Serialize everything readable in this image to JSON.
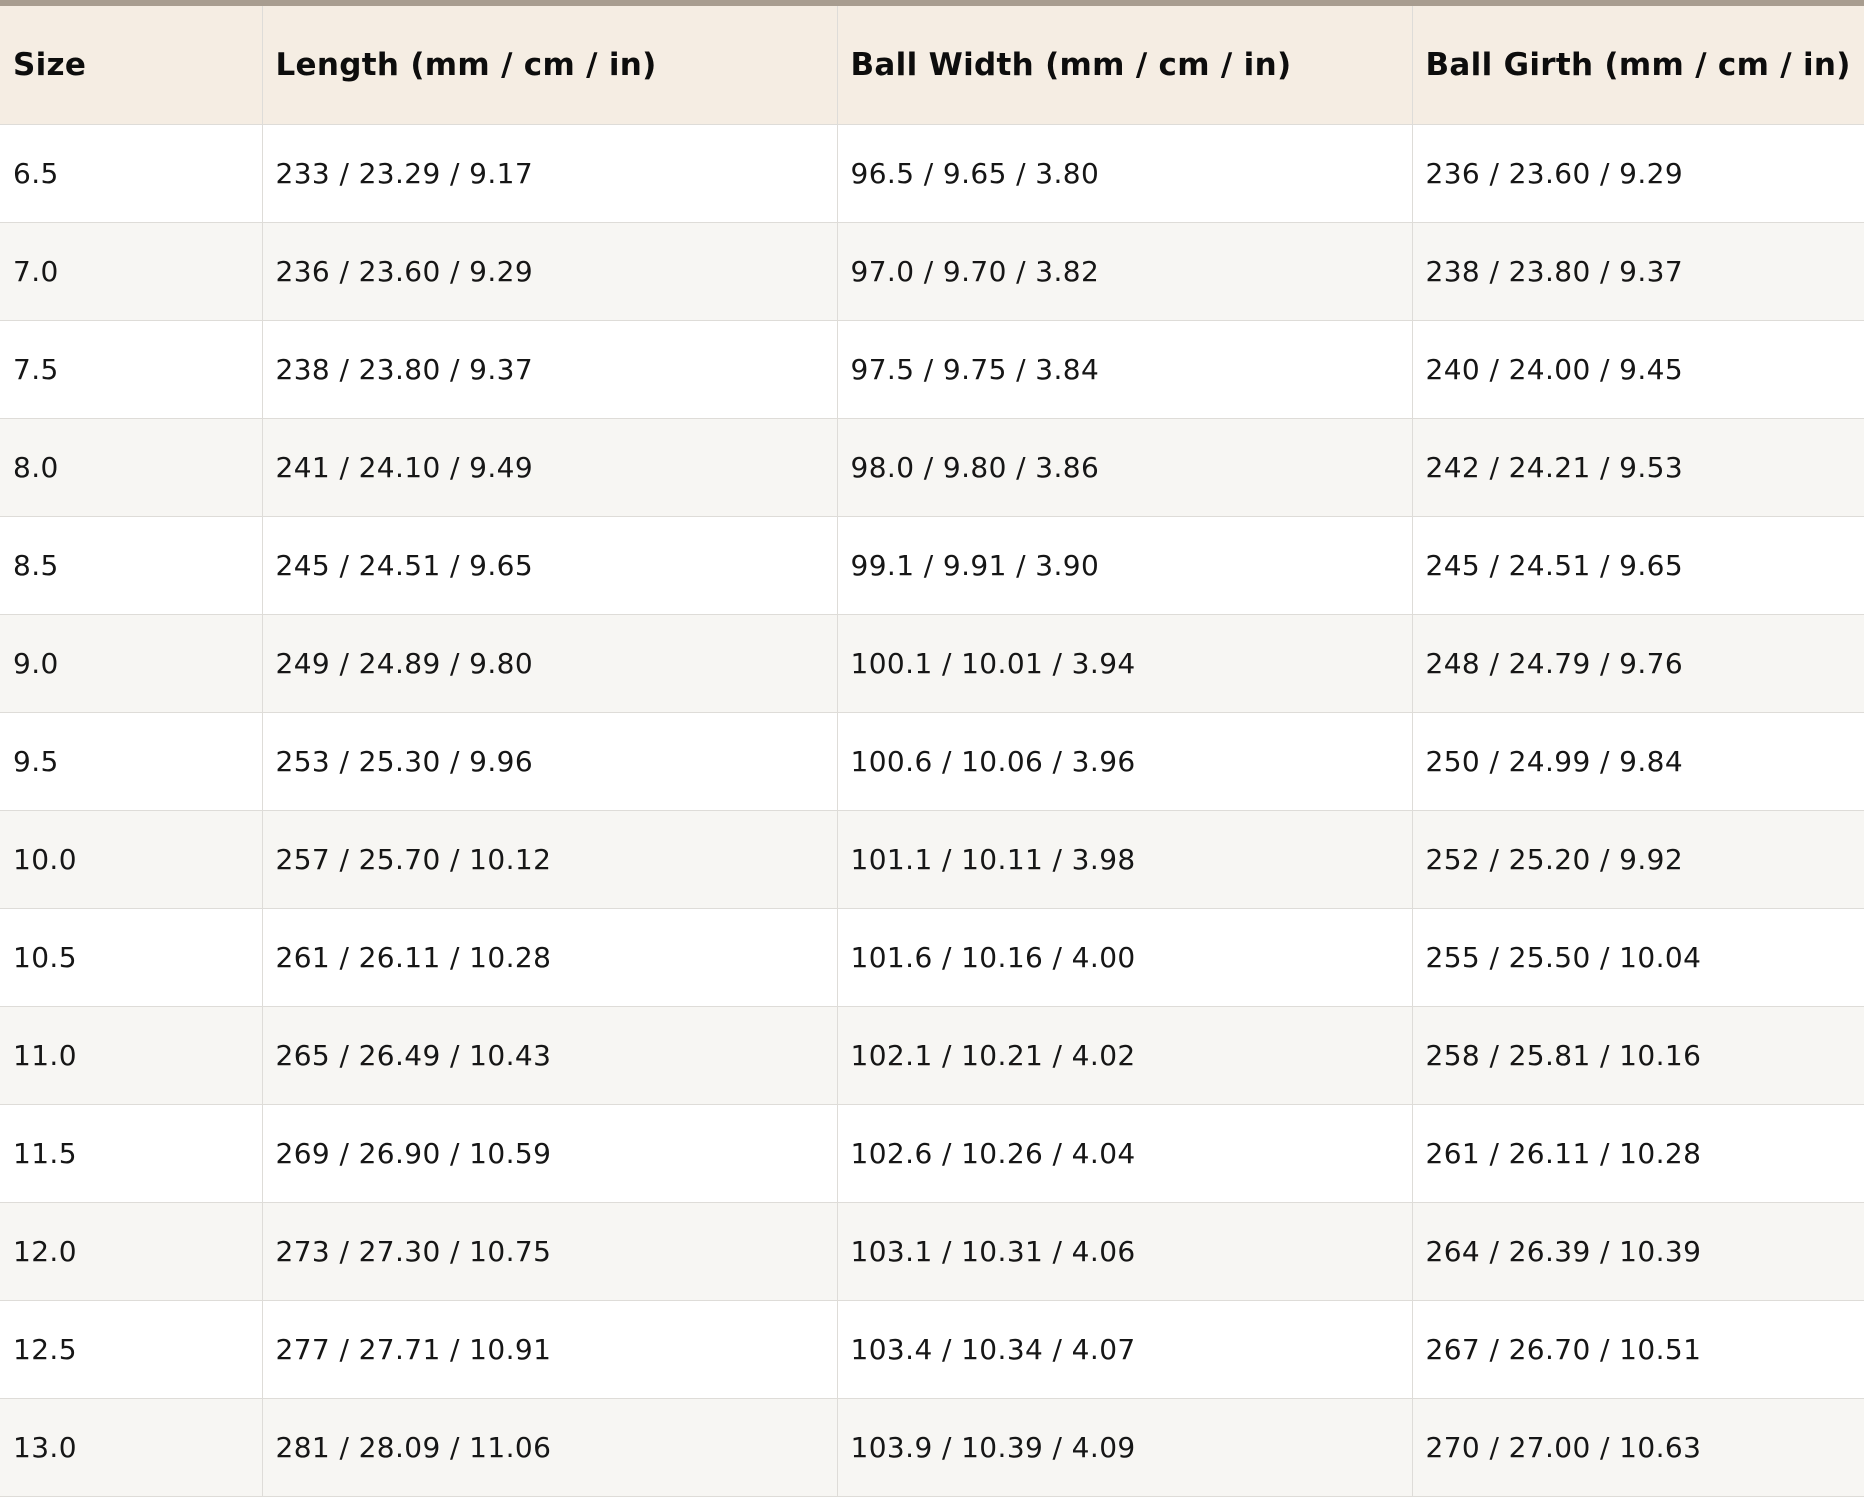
{
  "table": {
    "headers": [
      "Size",
      "Length (mm / cm / in)",
      "Ball Width (mm / cm / in)",
      "Ball Girth (mm / cm / in)"
    ],
    "rows": [
      [
        "6.5",
        "233 / 23.29 / 9.17",
        "96.5 / 9.65 / 3.80",
        "236 / 23.60 / 9.29"
      ],
      [
        "7.0",
        "236 / 23.60 / 9.29",
        "97.0 / 9.70 / 3.82",
        "238 / 23.80 / 9.37"
      ],
      [
        "7.5",
        "238 / 23.80 / 9.37",
        "97.5 / 9.75 / 3.84",
        "240 / 24.00 / 9.45"
      ],
      [
        "8.0",
        "241 / 24.10 / 9.49",
        "98.0 / 9.80 / 3.86",
        "242 / 24.21 / 9.53"
      ],
      [
        "8.5",
        "245 / 24.51 / 9.65",
        "99.1 / 9.91 / 3.90",
        "245 / 24.51 / 9.65"
      ],
      [
        "9.0",
        "249 / 24.89 / 9.80",
        "100.1 / 10.01 / 3.94",
        "248 / 24.79 / 9.76"
      ],
      [
        "9.5",
        "253 / 25.30 / 9.96",
        "100.6 / 10.06 / 3.96",
        "250 / 24.99 / 9.84"
      ],
      [
        "10.0",
        "257 / 25.70 / 10.12",
        "101.1 / 10.11 / 3.98",
        "252 / 25.20 / 9.92"
      ],
      [
        "10.5",
        "261 / 26.11 / 10.28",
        "101.6 / 10.16 / 4.00",
        "255 / 25.50 / 10.04"
      ],
      [
        "11.0",
        "265 / 26.49 / 10.43",
        "102.1 / 10.21 / 4.02",
        "258 / 25.81 / 10.16"
      ],
      [
        "11.5",
        "269 / 26.90 / 10.59",
        "102.6 / 10.26 / 4.04",
        "261 / 26.11 / 10.28"
      ],
      [
        "12.0",
        "273 / 27.30 / 10.75",
        "103.1 / 10.31 / 4.06",
        "264 / 26.39 / 10.39"
      ],
      [
        "12.5",
        "277 / 27.71 / 10.91",
        "103.4 / 10.34 / 4.07",
        "267 / 26.70 / 10.51"
      ],
      [
        "13.0",
        "281 / 28.09 / 11.06",
        "103.9 / 10.39 / 4.09",
        "270 / 27.00 / 10.63"
      ]
    ]
  },
  "colors": {
    "top_bar": "#a89d90",
    "header_bg": "#f5ede3",
    "row_alt_bg": "#f7f6f3",
    "border": "#dedcd8"
  }
}
